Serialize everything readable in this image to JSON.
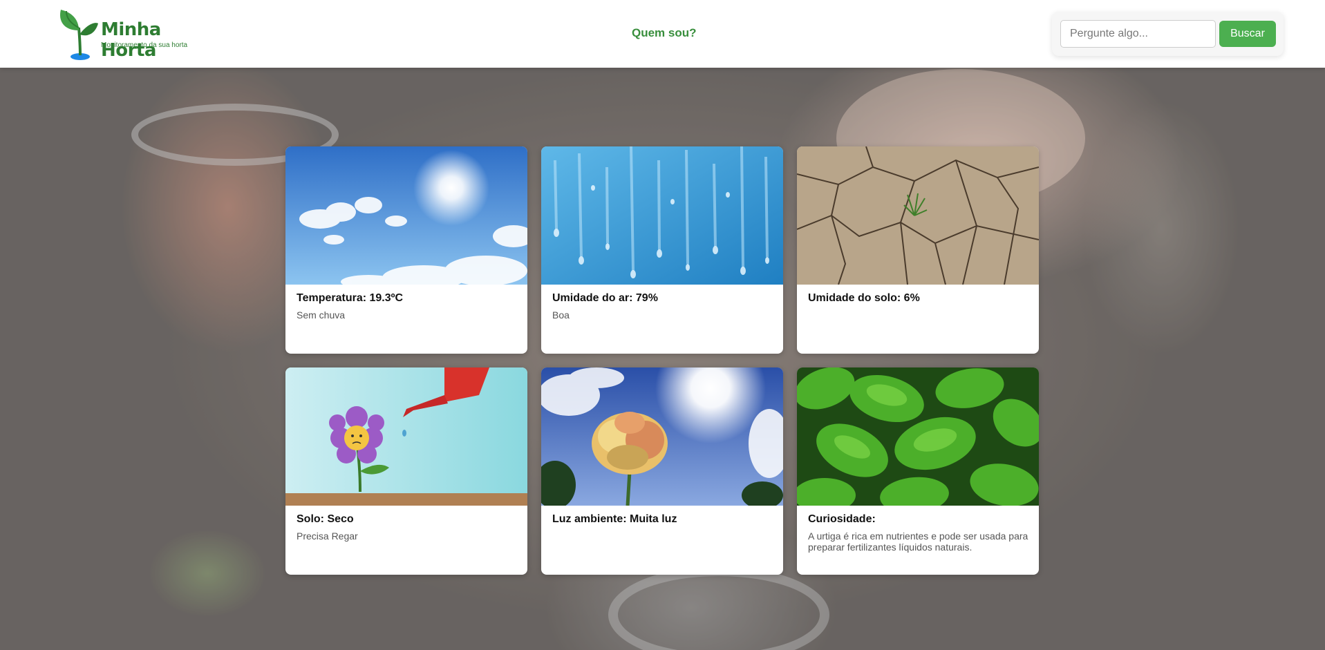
{
  "header": {
    "logo": {
      "title": "Minha Horta",
      "subtitle": "Monitoramento da sua horta",
      "color": "#2e7d32"
    },
    "nav": {
      "about_label": "Quem sou?"
    },
    "search": {
      "placeholder": "Pergunte algo...",
      "value": "",
      "button_label": "Buscar",
      "button_color": "#4caf50"
    }
  },
  "cards": [
    {
      "title": "Temperatura: 19.3ºC",
      "text": "Sem chuva",
      "image": "sunny-sky"
    },
    {
      "title": "Umidade do ar: 79%",
      "text": "Boa",
      "image": "water-droplets"
    },
    {
      "title": "Umidade do solo: 6%",
      "text": "",
      "image": "dry-cracked-soil"
    },
    {
      "title": "Solo: Seco",
      "text": "Precisa Regar",
      "image": "watering-can-flower"
    },
    {
      "title": "Luz ambiente: Muita luz",
      "text": "",
      "image": "flower-in-sun"
    },
    {
      "title": "Curiosidade:",
      "text": "A urtiga é rica em nutrientes e pode ser usada para preparar fertilizantes líquidos naturais.",
      "image": "nettle-leaves"
    }
  ]
}
